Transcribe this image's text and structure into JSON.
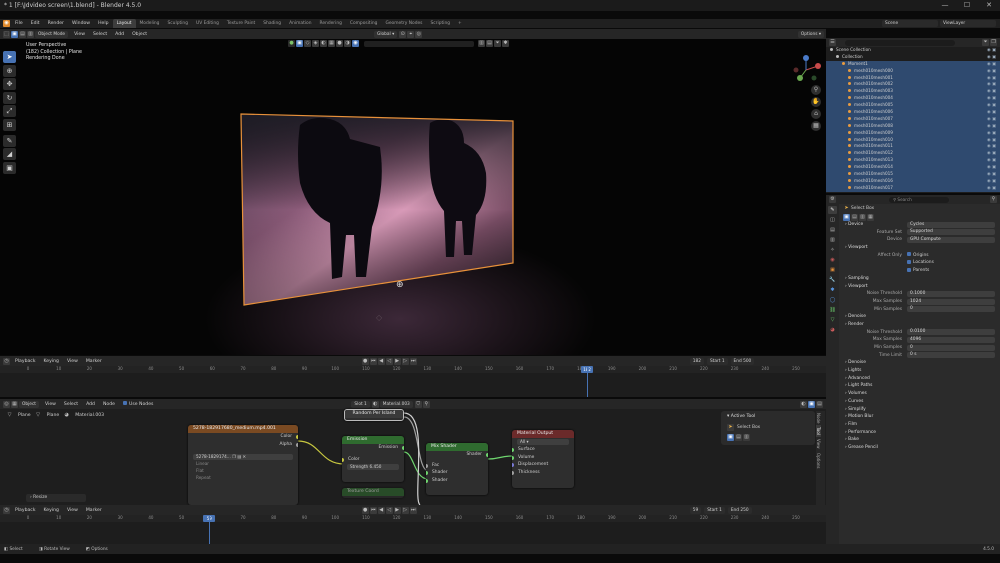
{
  "window": {
    "title": "* 1 [F:\\Jdvideo screen\\1.blend] - Blender 4.5.0",
    "buttons": [
      "—",
      "☐",
      "✕"
    ]
  },
  "menu": {
    "items": [
      "File",
      "Edit",
      "Render",
      "Window",
      "Help"
    ],
    "workspaces": [
      "Layout",
      "Modeling",
      "Sculpting",
      "UV Editing",
      "Texture Paint",
      "Shading",
      "Animation",
      "Rendering",
      "Compositing",
      "Geometry Nodes",
      "Scripting",
      "+"
    ],
    "active_workspace": "Layout",
    "scene_label": "Scene",
    "viewlayer_label": "ViewLayer"
  },
  "viewport_header": {
    "mode": "Object Mode",
    "menus": [
      "View",
      "Select",
      "Add",
      "Object"
    ],
    "transform_orientation": "Global",
    "options_label": "Options"
  },
  "viewport": {
    "info_lines": [
      "User Perspective",
      "(182) Collection | Plane",
      "Rendering Done"
    ],
    "background_color": "#0a0a0a",
    "selection_color": "#e8913a"
  },
  "timeline_top": {
    "menus": [
      "Playback",
      "Keying",
      "View",
      "Marker"
    ],
    "current_frame": "182",
    "start_label": "Start",
    "start_value": "1",
    "end_label": "End",
    "end_value": "500",
    "ticks": [
      "0",
      "10",
      "20",
      "30",
      "40",
      "50",
      "60",
      "70",
      "80",
      "90",
      "100",
      "110",
      "120",
      "130",
      "140",
      "150",
      "160",
      "170",
      "180",
      "190",
      "200",
      "210",
      "220",
      "230",
      "240",
      "250"
    ],
    "playhead_label": "182"
  },
  "node_editor": {
    "editor_type": "Object",
    "menus": [
      "View",
      "Select",
      "Add",
      "Node"
    ],
    "use_nodes_label": "Use Nodes",
    "slot": "Slot 1",
    "material": "Material.003",
    "breadcrumb": [
      "Plane",
      "Plane",
      "Material.003"
    ],
    "nodes": {
      "image": {
        "title": "5278-182917680_medium.mp4.001",
        "outputs": [
          "Color",
          "Alpha"
        ],
        "file_field": "5278-1829174...",
        "props": [
          "Linear",
          "Flat",
          "Repeat"
        ]
      },
      "random": {
        "title": "Random Per Island"
      },
      "emission": {
        "title": "Emission",
        "output": "Emission",
        "inputs": [
          "Color"
        ],
        "strength": "Strength",
        "strength_value": "6.450"
      },
      "mix": {
        "title": "Mix Shader",
        "output": "Shader",
        "inputs": [
          "Fac",
          "Shader",
          "Shader"
        ]
      },
      "output": {
        "title": "Material Output",
        "target": "All",
        "inputs": [
          "Surface",
          "Volume",
          "Displacement",
          "Thickness"
        ]
      },
      "extra": {
        "title": "Texture Coord"
      }
    },
    "resize_label": "Resize",
    "active_tool_title": "Active Tool",
    "active_tool_value": "Select Box",
    "side_tabs": [
      "Node",
      "Tool",
      "View",
      "Options"
    ]
  },
  "timeline_bottom": {
    "menus": [
      "Playback",
      "Keying",
      "View",
      "Marker"
    ],
    "current_frame": "59",
    "start_label": "Start",
    "start_value": "1",
    "end_label": "End",
    "end_value": "250",
    "ticks": [
      "0",
      "10",
      "20",
      "30",
      "40",
      "50",
      "60",
      "70",
      "80",
      "90",
      "100",
      "110",
      "120",
      "130",
      "140",
      "150",
      "160",
      "170",
      "180",
      "190",
      "200",
      "210",
      "220",
      "230",
      "240",
      "250"
    ],
    "playhead_label": "59"
  },
  "statusbar": {
    "items": [
      "Select",
      "Rotate View",
      "Options"
    ],
    "version": "4.5.0"
  },
  "outliner": {
    "search_placeholder": "",
    "rows": [
      "Scene Collection",
      "Collection",
      "Moment1",
      "mesh010mesh000",
      "mesh010mesh001",
      "mesh010mesh002",
      "mesh010mesh003",
      "mesh010mesh004",
      "mesh010mesh005",
      "mesh010mesh006",
      "mesh010mesh007",
      "mesh010mesh008",
      "mesh010mesh009",
      "mesh010mesh010",
      "mesh010mesh011",
      "mesh010mesh012",
      "mesh010mesh013",
      "mesh010mesh014",
      "mesh010mesh015",
      "mesh010mesh016",
      "mesh010mesh017"
    ]
  },
  "properties": {
    "search_placeholder": "Search",
    "object_name": "Select Box",
    "rows": [
      {
        "kind": "sect",
        "text": "Device",
        "label": "",
        "value": "Cycles"
      },
      {
        "kind": "field",
        "text": "",
        "label": "Feature Set",
        "value": "Supported"
      },
      {
        "kind": "field",
        "text": "",
        "label": "Device",
        "value": "GPU Compute"
      },
      {
        "kind": "sect",
        "text": "Viewport",
        "label": "",
        "value": ""
      },
      {
        "kind": "check",
        "text": "Origins",
        "label": "Affect Only",
        "value": ""
      },
      {
        "kind": "check",
        "text": "Locations",
        "label": "",
        "value": ""
      },
      {
        "kind": "check",
        "text": "Parents",
        "label": "",
        "value": ""
      },
      {
        "kind": "sect",
        "text": "Sampling",
        "label": "",
        "value": ""
      },
      {
        "kind": "sect",
        "text": "Viewport",
        "label": "",
        "value": ""
      },
      {
        "kind": "field",
        "text": "",
        "label": "Noise Threshold",
        "value": "0.1000"
      },
      {
        "kind": "field",
        "text": "",
        "label": "Max Samples",
        "value": "1024"
      },
      {
        "kind": "field",
        "text": "",
        "label": "Min Samples",
        "value": "0"
      },
      {
        "kind": "sect",
        "text": "Denoise",
        "label": "",
        "value": ""
      },
      {
        "kind": "sect",
        "text": "Render",
        "label": "",
        "value": ""
      },
      {
        "kind": "field",
        "text": "",
        "label": "Noise Threshold",
        "value": "0.0100"
      },
      {
        "kind": "field",
        "text": "",
        "label": "Max Samples",
        "value": "4096"
      },
      {
        "kind": "field",
        "text": "",
        "label": "Min Samples",
        "value": "0"
      },
      {
        "kind": "field",
        "text": "",
        "label": "Time Limit",
        "value": "0 s"
      },
      {
        "kind": "sect",
        "text": "Denoise",
        "label": "",
        "value": ""
      },
      {
        "kind": "sect",
        "text": "Lights",
        "label": "",
        "value": ""
      },
      {
        "kind": "sect",
        "text": "Advanced",
        "label": "",
        "value": ""
      },
      {
        "kind": "sect",
        "text": "Light Paths",
        "label": "",
        "value": ""
      },
      {
        "kind": "sect",
        "text": "Volumes",
        "label": "",
        "value": ""
      },
      {
        "kind": "sect",
        "text": "Curves",
        "label": "",
        "value": ""
      },
      {
        "kind": "sect",
        "text": "Simplify",
        "label": "",
        "value": ""
      },
      {
        "kind": "sect",
        "text": "Motion Blur",
        "label": "",
        "value": ""
      },
      {
        "kind": "sect",
        "text": "Film",
        "label": "",
        "value": ""
      },
      {
        "kind": "sect",
        "text": "Performance",
        "label": "",
        "value": ""
      },
      {
        "kind": "sect",
        "text": "Bake",
        "label": "",
        "value": ""
      },
      {
        "kind": "sect",
        "text": "Grease Pencil",
        "label": "",
        "value": ""
      }
    ]
  }
}
